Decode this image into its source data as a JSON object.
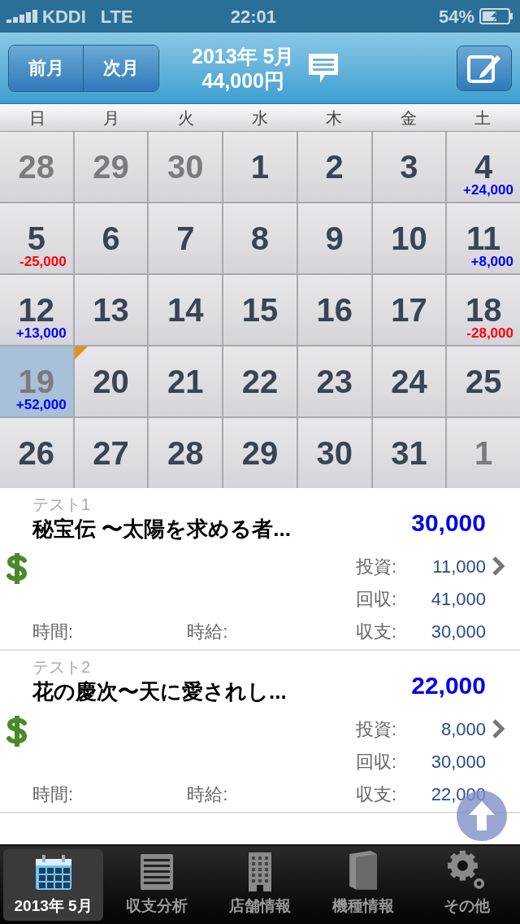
{
  "status_bar": {
    "carrier": "KDDI",
    "network": "LTE",
    "time": "22:01",
    "battery": "54%"
  },
  "nav": {
    "prev": "前月",
    "next": "次月",
    "month": "2013年 5月",
    "total": "44,000円"
  },
  "weekdays": [
    "日",
    "月",
    "火",
    "水",
    "木",
    "金",
    "土"
  ],
  "days": [
    {
      "day": "28",
      "dim": true,
      "selected": false,
      "flagged": false
    },
    {
      "day": "29",
      "dim": true,
      "selected": false,
      "flagged": false
    },
    {
      "day": "30",
      "dim": true,
      "selected": false,
      "flagged": false
    },
    {
      "day": "1",
      "dim": false,
      "selected": false,
      "flagged": false
    },
    {
      "day": "2",
      "dim": false,
      "selected": false,
      "flagged": false
    },
    {
      "day": "3",
      "dim": false,
      "selected": false,
      "flagged": false
    },
    {
      "day": "4",
      "dim": false,
      "selected": false,
      "flagged": false,
      "amount": "+24,000",
      "color": "#0000ff"
    },
    {
      "day": "5",
      "dim": false,
      "selected": false,
      "flagged": false,
      "amount": "-25,000",
      "color": "#ff0000"
    },
    {
      "day": "6",
      "dim": false,
      "selected": false,
      "flagged": false
    },
    {
      "day": "7",
      "dim": false,
      "selected": false,
      "flagged": false
    },
    {
      "day": "8",
      "dim": false,
      "selected": false,
      "flagged": false
    },
    {
      "day": "9",
      "dim": false,
      "selected": false,
      "flagged": false
    },
    {
      "day": "10",
      "dim": false,
      "selected": false,
      "flagged": false
    },
    {
      "day": "11",
      "dim": false,
      "selected": false,
      "flagged": false,
      "amount": "+8,000",
      "color": "#0000ff"
    },
    {
      "day": "12",
      "dim": false,
      "selected": false,
      "flagged": false,
      "amount": "+13,000",
      "color": "#0000ff"
    },
    {
      "day": "13",
      "dim": false,
      "selected": false,
      "flagged": false
    },
    {
      "day": "14",
      "dim": false,
      "selected": false,
      "flagged": false
    },
    {
      "day": "15",
      "dim": false,
      "selected": false,
      "flagged": false
    },
    {
      "day": "16",
      "dim": false,
      "selected": false,
      "flagged": false
    },
    {
      "day": "17",
      "dim": false,
      "selected": false,
      "flagged": false
    },
    {
      "day": "18",
      "dim": false,
      "selected": false,
      "flagged": false,
      "amount": "-28,000",
      "color": "#ff0000"
    },
    {
      "day": "19",
      "dim": false,
      "selected": true,
      "flagged": false,
      "amount": "+52,000",
      "color": "#0000ff"
    },
    {
      "day": "20",
      "dim": false,
      "selected": false,
      "flagged": true
    },
    {
      "day": "21",
      "dim": false,
      "selected": false,
      "flagged": false
    },
    {
      "day": "22",
      "dim": false,
      "selected": false,
      "flagged": false
    },
    {
      "day": "23",
      "dim": false,
      "selected": false,
      "flagged": false
    },
    {
      "day": "24",
      "dim": false,
      "selected": false,
      "flagged": false
    },
    {
      "day": "25",
      "dim": false,
      "selected": false,
      "flagged": false
    },
    {
      "day": "26",
      "dim": false,
      "selected": false,
      "flagged": false
    },
    {
      "day": "27",
      "dim": false,
      "selected": false,
      "flagged": false
    },
    {
      "day": "28",
      "dim": false,
      "selected": false,
      "flagged": false
    },
    {
      "day": "29",
      "dim": false,
      "selected": false,
      "flagged": false
    },
    {
      "day": "30",
      "dim": false,
      "selected": false,
      "flagged": false
    },
    {
      "day": "31",
      "dim": false,
      "selected": false,
      "flagged": false
    },
    {
      "day": "1",
      "dim": true,
      "selected": false,
      "flagged": false
    }
  ],
  "entries": [
    {
      "tag": "テスト1",
      "title": "秘宝伝 〜太陽を求める者...",
      "total": "30,000",
      "invest_label": "投資:",
      "invest": "11,000",
      "collect_label": "回収:",
      "collect": "41,000",
      "time_label": "時間:",
      "wage_label": "時給:",
      "balance_label": "収支:",
      "balance": "30,000"
    },
    {
      "tag": "テスト2",
      "title": "花の慶次〜天に愛されし...",
      "total": "22,000",
      "invest_label": "投資:",
      "invest": "8,000",
      "collect_label": "回収:",
      "collect": "30,000",
      "time_label": "時間:",
      "wage_label": "時給:",
      "balance_label": "収支:",
      "balance": "22,000"
    }
  ],
  "tabs": [
    {
      "label": "2013年 5月",
      "selected": true,
      "kind": "calendar"
    },
    {
      "label": "収支分析",
      "selected": false,
      "kind": "notepad"
    },
    {
      "label": "店舗情報",
      "selected": false,
      "kind": "building"
    },
    {
      "label": "機種情報",
      "selected": false,
      "kind": "book"
    },
    {
      "label": "その他",
      "selected": false,
      "kind": "gears"
    }
  ]
}
